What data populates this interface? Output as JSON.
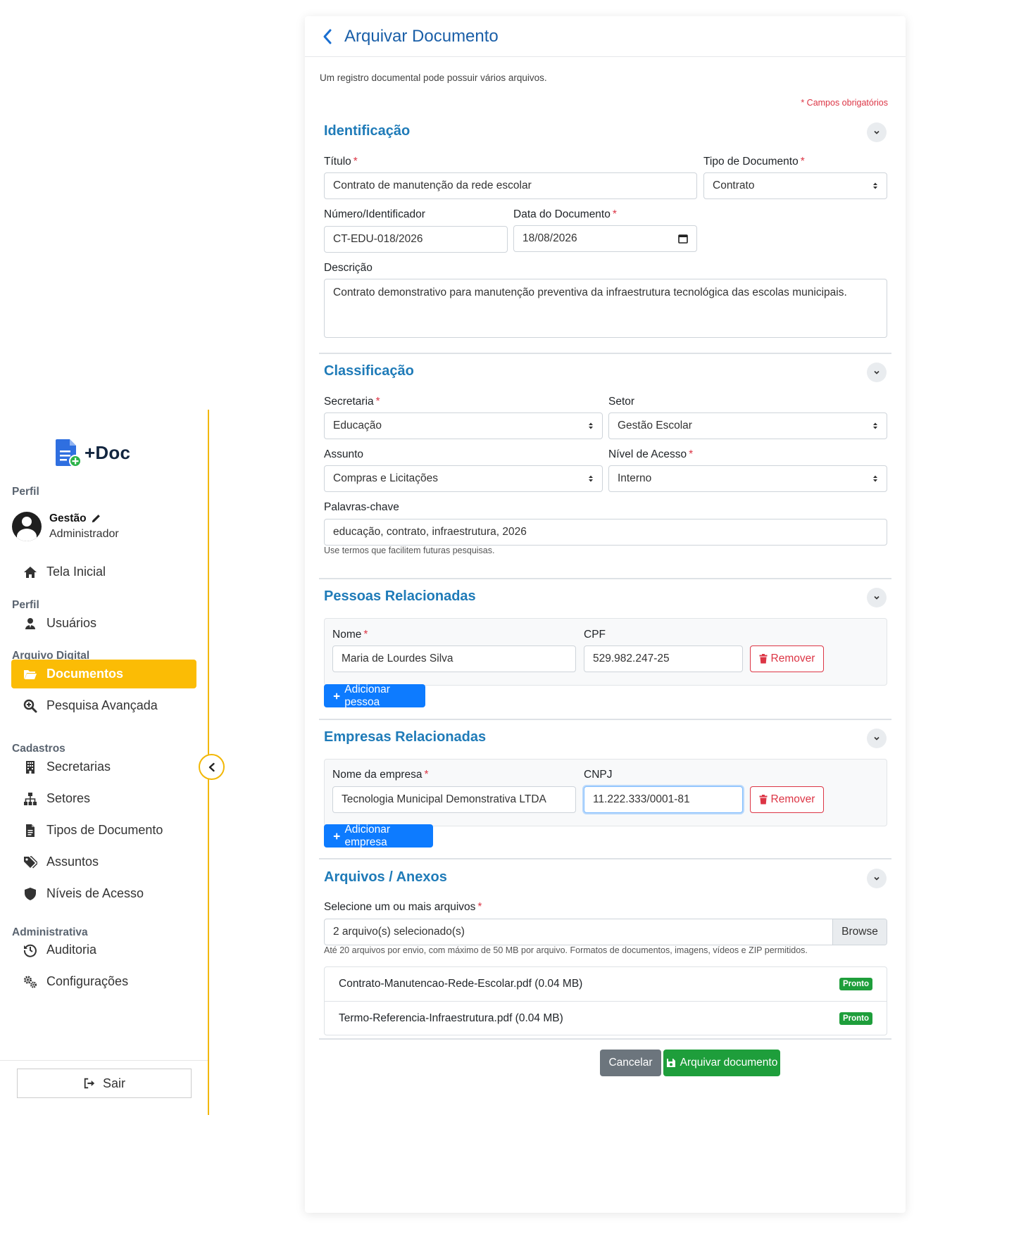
{
  "sidebar": {
    "brand": "+Doc",
    "profile_section": "Perfil",
    "profile_name": "Gestão",
    "profile_role": "Administrador",
    "home": "Tela Inicial",
    "section_profile": "Perfil",
    "users": "Usuários",
    "section_archive": "Arquivo Digital",
    "documents": "Documentos",
    "advanced_search": "Pesquisa Avançada",
    "section_registers": "Cadastros",
    "departments": "Secretarias",
    "sectors": "Setores",
    "doc_types": "Tipos de Documento",
    "subjects": "Assuntos",
    "access_levels": "Níveis de Acesso",
    "section_admin": "Administrativa",
    "audit": "Auditoria",
    "settings": "Configurações",
    "logout": "Sair",
    "accent_color": "#fbbc05"
  },
  "page": {
    "title": "Arquivar Documento",
    "intro": "Um registro documental pode possuir vários arquivos.",
    "required_note": "* Campos obrigatórios"
  },
  "identification": {
    "title": "Identificação",
    "title_label": "Título",
    "title_value": "Contrato de manutenção da rede escolar",
    "type_label": "Tipo de Documento",
    "type_value": "Contrato",
    "number_label": "Número/Identificador",
    "number_value": "CT-EDU-018/2026",
    "date_label": "Data do Documento",
    "date_value": "18/08/2026",
    "description_label": "Descrição",
    "description_value": "Contrato demonstrativo para manutenção preventiva da infraestrutura tecnológica das escolas municipais."
  },
  "classification": {
    "title": "Classificação",
    "department_label": "Secretaria",
    "department_value": "Educação",
    "sector_label": "Setor",
    "sector_value": "Gestão Escolar",
    "subject_label": "Assunto",
    "subject_value": "Compras e Licitações",
    "access_label": "Nível de Acesso",
    "access_value": "Interno",
    "keywords_label": "Palavras-chave",
    "keywords_value": "educação, contrato, infraestrutura, 2026",
    "keywords_help": "Use termos que facilitem futuras pesquisas."
  },
  "people": {
    "title": "Pessoas Relacionadas",
    "name_label": "Nome",
    "name_value": "Maria de Lourdes Silva",
    "cpf_label": "CPF",
    "cpf_value": "529.982.247-25",
    "remove": "Remover",
    "add": "Adicionar pessoa"
  },
  "companies": {
    "title": "Empresas Relacionadas",
    "name_label": "Nome da empresa",
    "name_value": "Tecnologia Municipal Demonstrativa LTDA",
    "cnpj_label": "CNPJ",
    "cnpj_value": "11.222.333/0001-81",
    "remove": "Remover",
    "add": "Adicionar empresa"
  },
  "files": {
    "title": "Arquivos / Anexos",
    "select_label": "Selecione um ou mais arquivos",
    "selected_text": "2 arquivo(s) selecionado(s)",
    "browse": "Browse",
    "help": "Até 20 arquivos por envio, com máximo de 50 MB por arquivo. Formatos de documentos, imagens, vídeos e ZIP permitidos.",
    "items": [
      {
        "name": "Contrato-Manutencao-Rede-Escolar.pdf (0.04 MB)",
        "status": "Pronto"
      },
      {
        "name": "Termo-Referencia-Infraestrutura.pdf (0.04 MB)",
        "status": "Pronto"
      }
    ]
  },
  "actions": {
    "cancel": "Cancelar",
    "submit": "Arquivar documento"
  }
}
